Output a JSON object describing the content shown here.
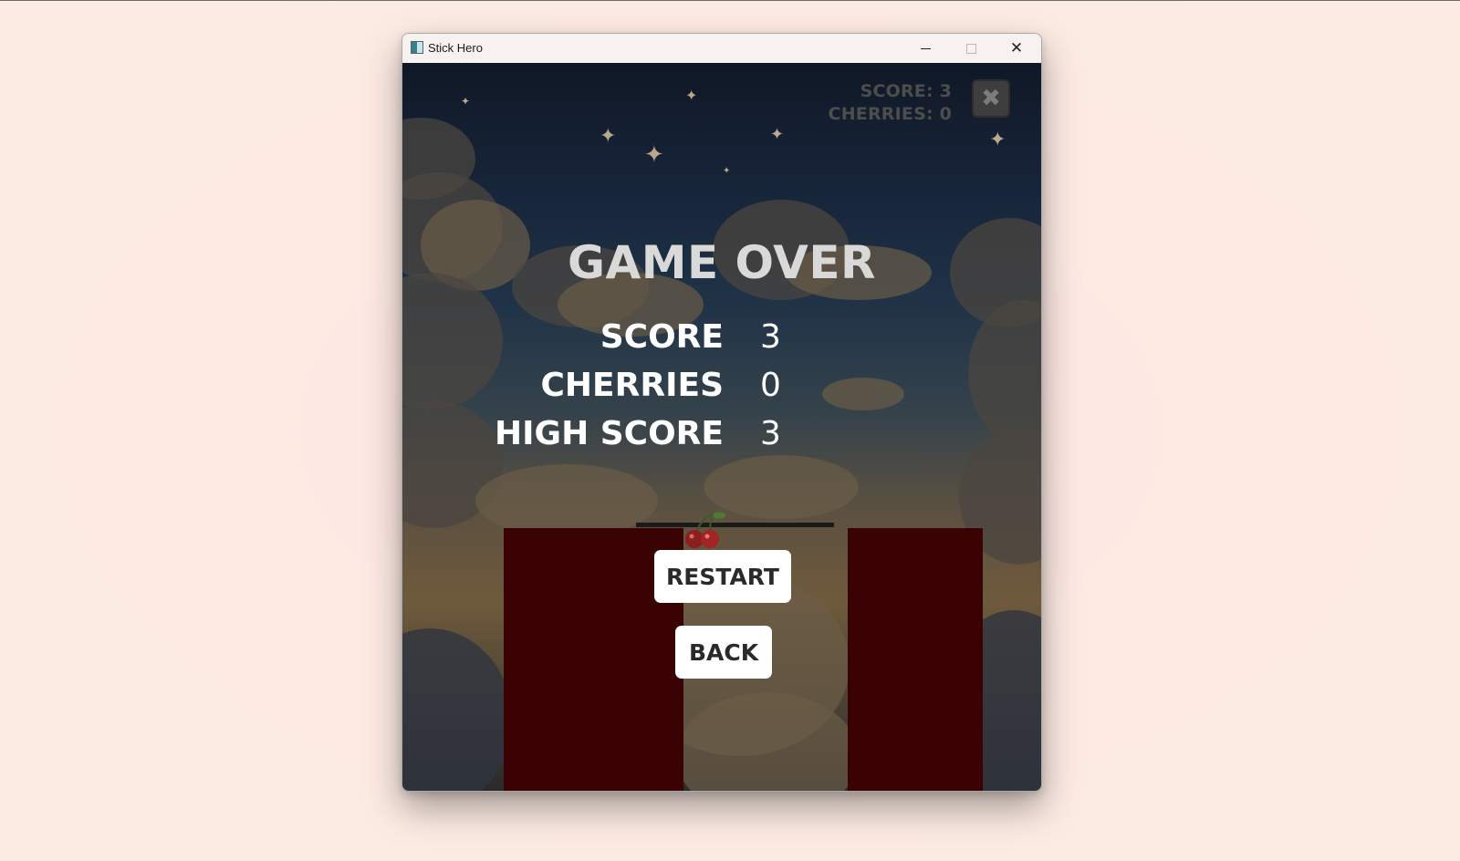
{
  "window": {
    "title": "Stick Hero",
    "icon": "app-window-icon",
    "controls": [
      "minimize-icon",
      "maximize-icon",
      "close-icon"
    ],
    "close_glyph": "✕"
  },
  "hud": {
    "score_text": "SCORE: 3",
    "cherries_text": "CHERRIES: 0",
    "close_glyph": "✖"
  },
  "game_over": {
    "title": "GAME OVER",
    "stats": [
      {
        "label": "SCORE",
        "value": "3"
      },
      {
        "label": "CHERRIES",
        "value": "0"
      },
      {
        "label": "HIGH SCORE",
        "value": "3"
      }
    ],
    "buttons": {
      "restart_label": "RESTART",
      "back_label": "BACK"
    }
  },
  "colors": {
    "pillar": "#3a0202",
    "button_bg": "#ffffff",
    "title_text": "#d9d9d9",
    "page_background": "#fdeae3"
  }
}
